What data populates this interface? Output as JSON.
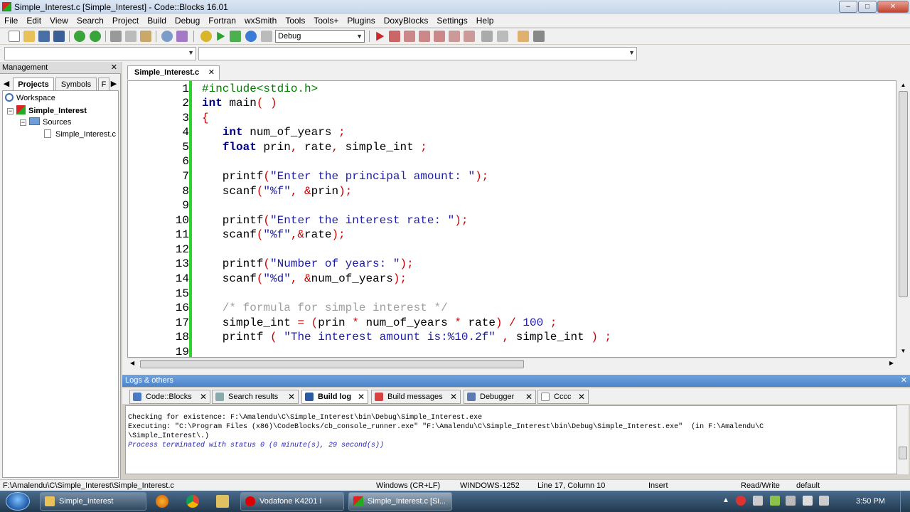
{
  "window": {
    "title": "Simple_Interest.c [Simple_Interest] - Code::Blocks 16.01",
    "minimize": "–",
    "maximize": "□",
    "close": "✕"
  },
  "menu": [
    "File",
    "Edit",
    "View",
    "Search",
    "Project",
    "Build",
    "Debug",
    "Fortran",
    "wxSmith",
    "Tools",
    "Tools+",
    "Plugins",
    "DoxyBlocks",
    "Settings",
    "Help"
  ],
  "toolbar": {
    "build_target": "Debug"
  },
  "management": {
    "title": "Management",
    "close": "✕",
    "tabs": [
      "Projects",
      "Symbols",
      "F"
    ],
    "tree": {
      "workspace": "Workspace",
      "project": "Simple_Interest",
      "folder": "Sources",
      "file": "Simple_Interest.c"
    }
  },
  "editor": {
    "tab_label": "Simple_Interest.c",
    "tab_close": "✕",
    "line_numbers": [
      "1",
      "2",
      "3",
      "4",
      "5",
      "6",
      "7",
      "8",
      "9",
      "10",
      "11",
      "12",
      "13",
      "14",
      "15",
      "16",
      "17",
      "18",
      "19"
    ]
  },
  "logs": {
    "title": "Logs & others",
    "tabs": [
      "Code::Blocks",
      "Search results",
      "Build log",
      "Build messages",
      "Debugger",
      "Cccc"
    ],
    "lines": [
      "Checking for existence: F:\\Amalendu\\C\\Simple_Interest\\bin\\Debug\\Simple_Interest.exe",
      "Executing: \"C:\\Program Files (x86)\\CodeBlocks/cb_console_runner.exe\" \"F:\\Amalendu\\C\\Simple_Interest\\bin\\Debug\\Simple_Interest.exe\"  (in F:\\Amalendu\\C",
      "\\Simple_Interest\\.)",
      "Process terminated with status 0 (0 minute(s), 29 second(s))"
    ]
  },
  "status": {
    "path": "F:\\Amalendu\\C\\Simple_Interest\\Simple_Interest.c",
    "eol": "Windows (CR+LF)",
    "encoding": "WINDOWS-1252",
    "position": "Line 17, Column 10",
    "mode": "Insert",
    "access": "Read/Write",
    "lang": "default"
  },
  "taskbar": {
    "items": [
      "Simple_Interest",
      "Vodafone K4201 I",
      "Simple_Interest.c [Si..."
    ],
    "time": "3:50 PM"
  },
  "colors": {
    "change_bar": "#2dd42d",
    "keyword": "#00008b",
    "string": "#1d1da8",
    "operator": "#cc0000",
    "comment": "#a0a0a0"
  }
}
